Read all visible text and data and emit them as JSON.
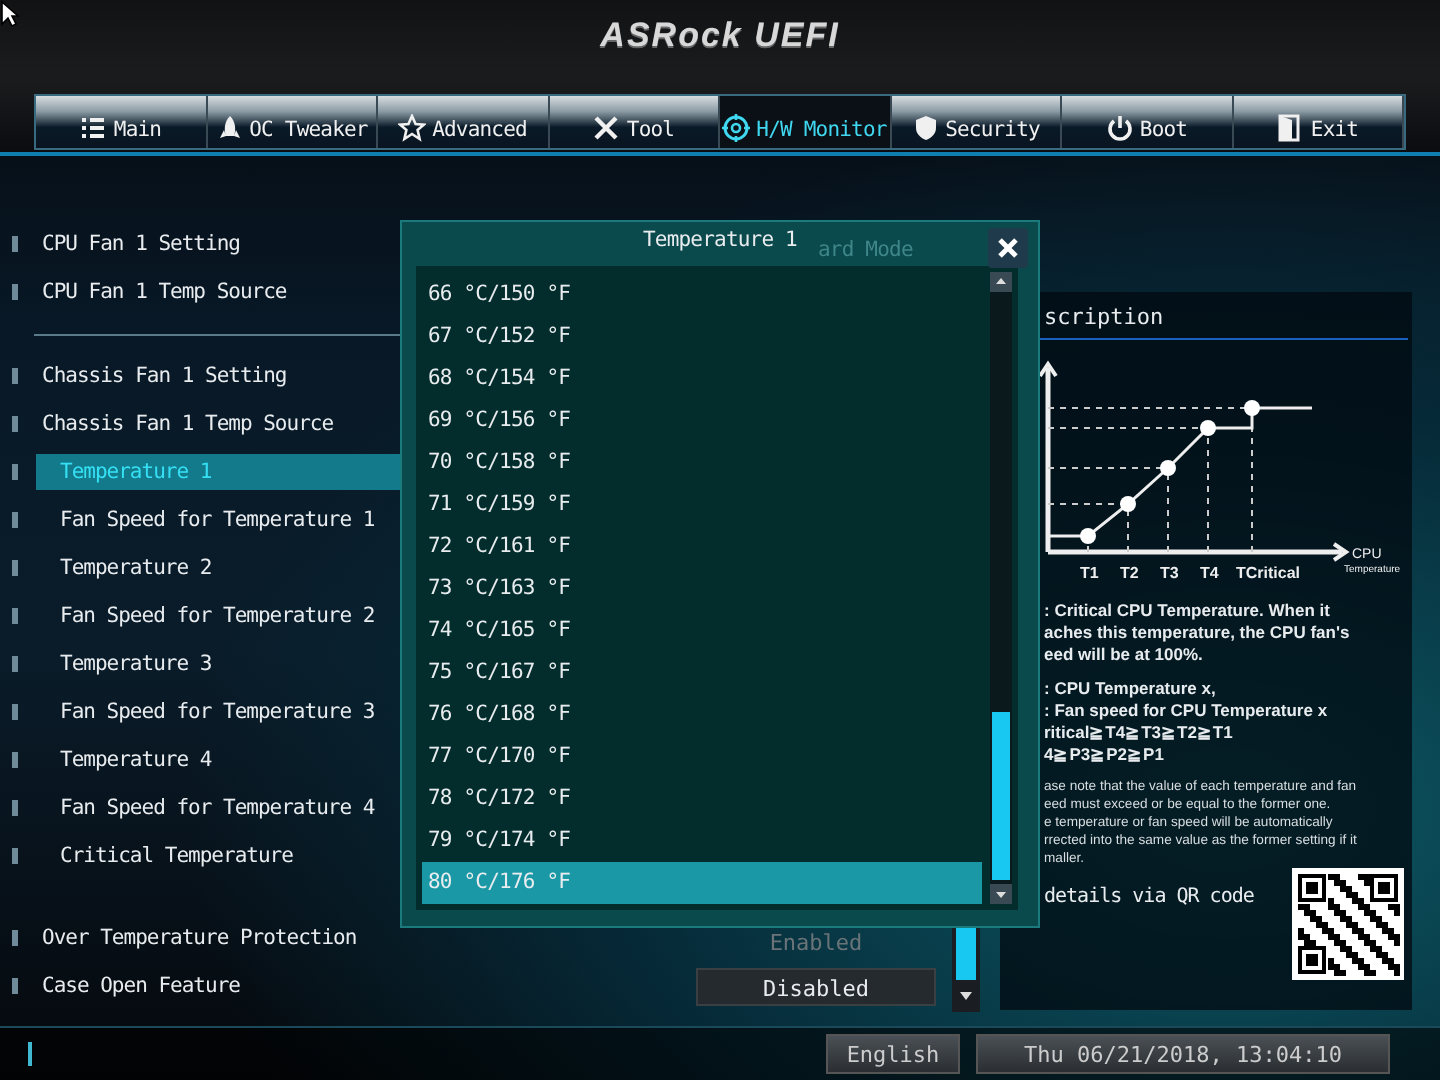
{
  "header": {
    "logo": "ASRock UEFI"
  },
  "tabs": [
    {
      "label": "Main",
      "selected": false
    },
    {
      "label": "OC Tweaker",
      "selected": false
    },
    {
      "label": "Advanced",
      "selected": false
    },
    {
      "label": "Tool",
      "selected": false
    },
    {
      "label": "H/W Monitor",
      "selected": true
    },
    {
      "label": "Security",
      "selected": false
    },
    {
      "label": "Boot",
      "selected": false
    },
    {
      "label": "Exit",
      "selected": false
    }
  ],
  "settings_groups": [
    {
      "rule_after": true,
      "items": [
        {
          "label": "CPU Fan 1 Setting",
          "selected": false
        },
        {
          "label": "CPU Fan 1 Temp Source",
          "selected": false
        }
      ]
    },
    {
      "rule_after": false,
      "items": [
        {
          "label": "Chassis Fan 1 Setting",
          "selected": false
        },
        {
          "label": "Chassis Fan 1 Temp Source",
          "selected": false,
          "children": [
            {
              "label": "Temperature 1",
              "selected": true
            },
            {
              "label": "Fan Speed for Temperature 1",
              "selected": false
            },
            {
              "label": "Temperature 2",
              "selected": false
            },
            {
              "label": "Fan Speed for Temperature 2",
              "selected": false
            },
            {
              "label": "Temperature 3",
              "selected": false
            },
            {
              "label": "Fan Speed for Temperature 3",
              "selected": false
            },
            {
              "label": "Temperature 4",
              "selected": false
            },
            {
              "label": "Fan Speed for Temperature 4",
              "selected": false
            },
            {
              "label": "Critical Temperature",
              "selected": false
            }
          ]
        }
      ]
    },
    {
      "rule_after": false,
      "items": [
        {
          "label": "Over Temperature Protection",
          "selected": false,
          "value": "Enabled",
          "dimmed": true
        },
        {
          "label": "Case Open Feature",
          "selected": false,
          "value": "Disabled",
          "dimmed": false
        }
      ]
    }
  ],
  "description": {
    "title": "scription",
    "chart_labels": [
      "T1",
      "T2",
      "T3",
      "T4",
      "TCritical"
    ],
    "axis_label": [
      "CPU",
      "Temperature"
    ],
    "lines": [
      ": Critical CPU Temperature. When it",
      "aches this temperature, the CPU fan's",
      "eed will be at 100%."
    ],
    "lines_2": [
      ": CPU Temperature x,",
      ": Fan speed for CPU Temperature x",
      "ritical≧T4≧T3≧T2≧T1",
      "4≧P3≧P2≧P1"
    ],
    "note": [
      "ase note that the value of each temperature and fan",
      "eed must exceed or be equal to the former one.",
      "e temperature or fan speed will be automatically",
      "rrected into the same value as the former setting if it",
      "maller."
    ],
    "qr_text": "details via QR code"
  },
  "modal": {
    "title": "Temperature 1",
    "ghost_text": "ard Mode",
    "options": [
      {
        "label": "66 °C/150 °F",
        "selected": false
      },
      {
        "label": "67 °C/152 °F",
        "selected": false
      },
      {
        "label": "68 °C/154 °F",
        "selected": false
      },
      {
        "label": "69 °C/156 °F",
        "selected": false
      },
      {
        "label": "70 °C/158 °F",
        "selected": false
      },
      {
        "label": "71 °C/159 °F",
        "selected": false
      },
      {
        "label": "72 °C/161 °F",
        "selected": false
      },
      {
        "label": "73 °C/163 °F",
        "selected": false
      },
      {
        "label": "74 °C/165 °F",
        "selected": false
      },
      {
        "label": "75 °C/167 °F",
        "selected": false
      },
      {
        "label": "76 °C/168 °F",
        "selected": false
      },
      {
        "label": "77 °C/170 °F",
        "selected": false
      },
      {
        "label": "78 °C/172 °F",
        "selected": false
      },
      {
        "label": "79 °C/174 °F",
        "selected": false
      },
      {
        "label": "80 °C/176 °F",
        "selected": true
      }
    ]
  },
  "status_bar": {
    "language": "English",
    "datetime": "Thu 06/21/2018, 13:04:10"
  }
}
